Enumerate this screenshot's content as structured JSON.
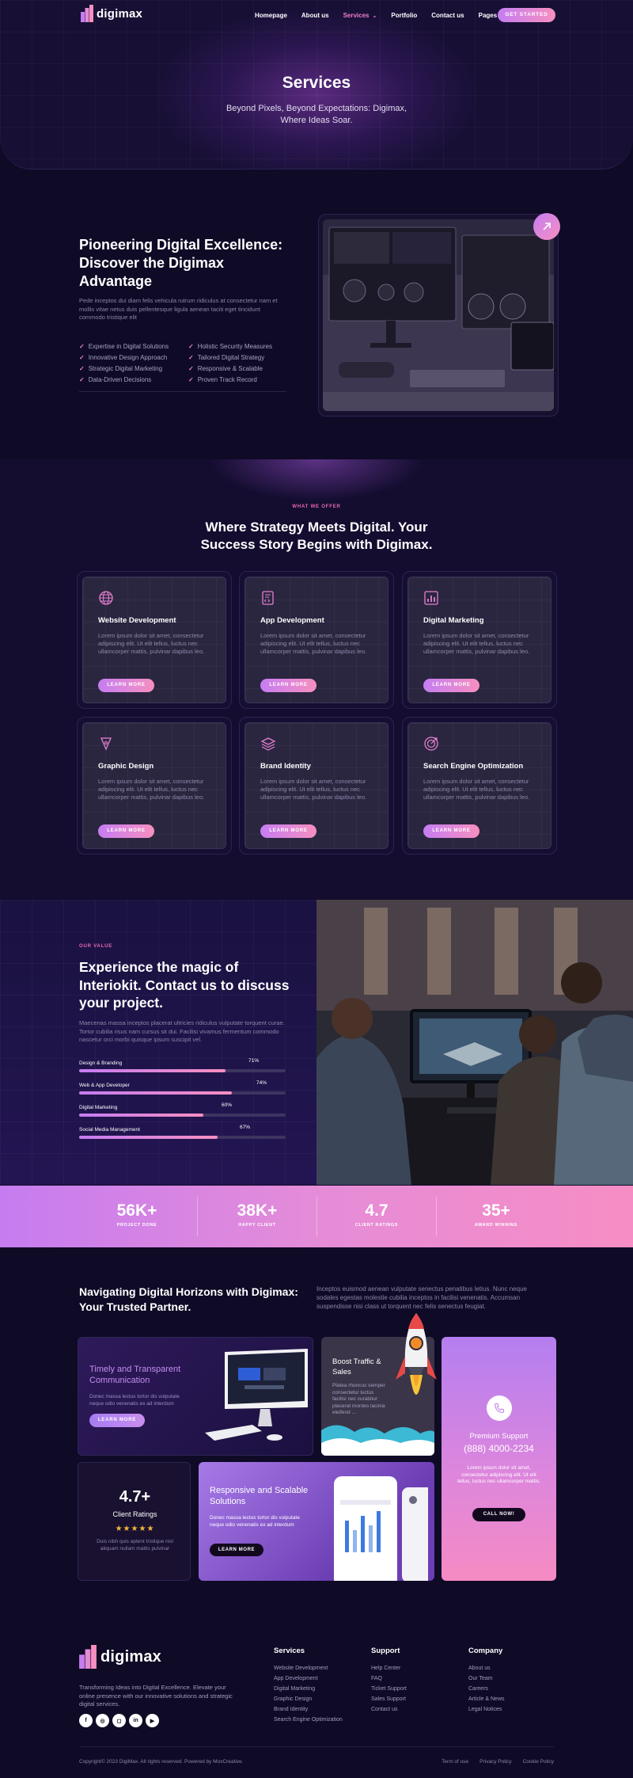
{
  "brand": {
    "name": "digimax"
  },
  "nav": {
    "links": [
      "Homepage",
      "About us",
      "Services",
      "Portfolio",
      "Contact us",
      "Pages"
    ],
    "active": "Services",
    "cta": "GET STARTED"
  },
  "hero": {
    "title": "Services",
    "subtitle": "Beyond Pixels, Beyond Expectations: Digimax, Where Ideas Soar."
  },
  "about": {
    "title": "Pioneering Digital Excellence: Discover the Digimax Advantage",
    "text": "Pede inceptos dui diam felis vehicula rutrum ridiculus at consectetur nam et mollis vitae netus duis pellentesque ligula aenean taciti eget tincidunt commodo tristique elit",
    "features": [
      "Expertise in Digital Solutions",
      "Holistic Security Measures",
      "Innovative Design Approach",
      "Tailored Digital Strategy",
      "Strategic Digital Marketing",
      "Responsive & Scalable",
      "Data-Driven Decisions",
      "Proven Track Record"
    ]
  },
  "services": {
    "eyebrow": "WHAT WE OFFER",
    "title": "Where Strategy Meets Digital. Your Success Story Begins with Digimax.",
    "items": [
      {
        "title": "Website Development",
        "text": "Lorem ipsum dolor sit amet, consectetur adipiscing elit. Ut elit tellus, luctus nec ullamcorper mattis, pulvinar dapibus leo.",
        "button": "LEARN MORE",
        "icon": "globe-icon"
      },
      {
        "title": "App Development",
        "text": "Lorem ipsum dolor sit amet, consectetur adipiscing elit. Ut elit tellus, luctus nec ullamcorper mattis, pulvinar dapibus leo.",
        "button": "LEARN MORE",
        "icon": "code-file-icon"
      },
      {
        "title": "Digital Marketing",
        "text": "Lorem ipsum dolor sit amet, consectetur adipiscing elit. Ut elit tellus, luctus nec ullamcorper mattis, pulvinar dapibus leo.",
        "button": "LEARN MORE",
        "icon": "chart-icon"
      },
      {
        "title": "Graphic Design",
        "text": "Lorem ipsum dolor sit amet, consectetur adipiscing elit. Ut elit tellus, luctus nec ullamcorper mattis, pulvinar dapibus leo.",
        "button": "LEARN MORE",
        "icon": "pen-nib-icon"
      },
      {
        "title": "Brand Identity",
        "text": "Lorem ipsum dolor sit amet, consectetur adipiscing elit. Ut elit tellus, luctus nec ullamcorper mattis, pulvinar dapibus leo.",
        "button": "LEARN MORE",
        "icon": "layers-icon"
      },
      {
        "title": "Search Engine Optimization",
        "text": "Lorem ipsum dolor sit amet, consectetur adipiscing elit. Ut elit tellus, luctus nec ullamcorper mattis, pulvinar dapibus leo.",
        "button": "LEARN MORE",
        "icon": "target-icon"
      }
    ]
  },
  "value": {
    "eyebrow": "OUR VALUE",
    "title": "Experience the magic of Interiokit. Contact us to discuss your project.",
    "text": "Maecenas massa inceptos placerat ultricies ridiculus vulputate torquent curae. Tortor cubilia risus nam cursus sit dui. Facilisi vivamus fermentum commodo nascetur orci morbi quisque ipsum suscipit vel.",
    "skills": [
      {
        "label": "Design & Branding",
        "pct": "71%",
        "value": 71
      },
      {
        "label": "Web & App Developer",
        "pct": "74%",
        "value": 74
      },
      {
        "label": "Digital Marketing",
        "pct": "60%",
        "value": 60
      },
      {
        "label": "Social Media Management",
        "pct": "67%",
        "value": 67
      }
    ]
  },
  "stats": [
    {
      "num": "56K+",
      "label": "PROJECT DONE"
    },
    {
      "num": "38K+",
      "label": "HAPPY CLIENT"
    },
    {
      "num": "4.7",
      "label": "CLIENT RATINGS"
    },
    {
      "num": "35+",
      "label": "AWARD WINNING"
    }
  ],
  "horizons": {
    "title": "Navigating Digital Horizons with Digimax: Your Trusted Partner.",
    "text": "Inceptos euismod aenean vulputate senectus penatibus letius. Nunc neque sodales egestas molestie cubilia inceptos in facilisi venenatis. Accumsan suspendisse nisi class ut torquent nec felis senectus feugiat."
  },
  "bento": {
    "timely": {
      "title": "Timely and Transparent Communication",
      "text": "Donec massa lectus tortor dis vulputate neque odio venenatis ex ad interdum",
      "button": "LEARN MORE"
    },
    "boost": {
      "title": "Boost Traffic & Sales",
      "text": "Platea rhoncus semper consectetur luctus facilisi nec curabitur placerat montes lacinia eleifend ..."
    },
    "support": {
      "title": "Premium Support",
      "phone": "(888) 4000-2234",
      "text": "Lorem ipsum dolor sit amet, consectetur adipiscing elit. Ut elit tellus, luctus nec ullamcorper mattis.",
      "button": "CALL NOW!"
    },
    "ratings": {
      "num": "4.7+",
      "label": "Client Ratings",
      "stars": "★★★★★",
      "rating_value": 4.7,
      "text": "Duis nibh quis aptent tristique nisl aliquam nullam mattis pulvinar"
    },
    "responsive": {
      "title": "Responsive and Scalable Solutions",
      "text": "Donec massa lectus tortor dis vulputate neque odio venenatis ex ad interdum",
      "button": "LEARN MORE"
    }
  },
  "footer": {
    "brand": "digimax",
    "description": "Transforming Ideas into Digital Excellence. Elevate your online presence with our innovative solutions and strategic digital services.",
    "socials": [
      "facebook-icon",
      "dribbble-icon",
      "instagram-icon",
      "linkedin-icon",
      "youtube-icon"
    ],
    "columns": [
      {
        "title": "Services",
        "links": [
          "Website Development",
          "App Development",
          "Digital Marketing",
          "Graphic Design",
          "Brand Identity",
          "Search Engine Optimization"
        ]
      },
      {
        "title": "Support",
        "links": [
          "Help Center",
          "FAQ",
          "Ticket Support",
          "Sales Support",
          "Contact us"
        ]
      },
      {
        "title": "Company",
        "links": [
          "About us",
          "Our Team",
          "Careers",
          "Article & News",
          "Legal Notices"
        ]
      }
    ],
    "copyright": "Copyright© 2023 DigiMax. All rights reserved. Powered by MoxCreative.",
    "legal": [
      "Term of use",
      "Privacy Policy",
      "Cookie Policy"
    ]
  },
  "colors": {
    "accent_start": "#c57df2",
    "accent_end": "#f78fc0",
    "background": "#0f0a26"
  }
}
